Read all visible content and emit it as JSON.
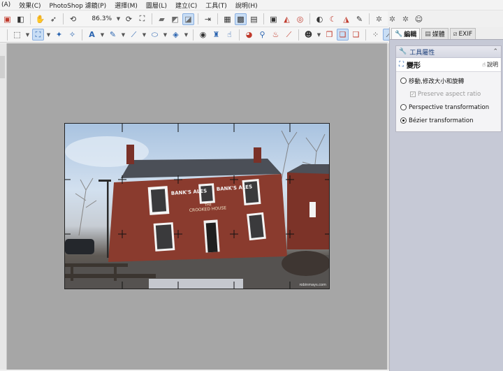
{
  "menu": [
    "(A)",
    "效果(C)",
    "PhotoShop 濾鏡(P)",
    "選擇(M)",
    "圖層(L)",
    "建立(C)",
    "工具(T)",
    "說明(H)"
  ],
  "toolbar": {
    "zoom": "86.3%"
  },
  "right_panel": {
    "tabs": [
      {
        "label": "編輯",
        "icon": "wrench-icon"
      },
      {
        "label": "媒體",
        "icon": "media-icon"
      },
      {
        "label": "EXIF",
        "icon": "exif-icon"
      }
    ],
    "tool_panel": {
      "header": "工具屬性",
      "tool_name": "變形",
      "help_label": "說明",
      "options": {
        "move": "移動,修改大小和旋轉",
        "preserve_aspect": "Preserve aspect ratio",
        "perspective": "Perspective transformation",
        "bezier": "Bézier transformation"
      }
    }
  },
  "photo": {
    "sign_left": "BANK'S ALES",
    "sign_right": "BANK'S ALES",
    "sign_center_1": "THE",
    "sign_center_2": "CROOKED HOUSE",
    "watermark": "robinmays.com"
  },
  "colors": {
    "canvas": "#a6a6a6",
    "panel": "#c6c9d6",
    "brick": "#8a3b2e",
    "roof": "#4b4f57"
  }
}
